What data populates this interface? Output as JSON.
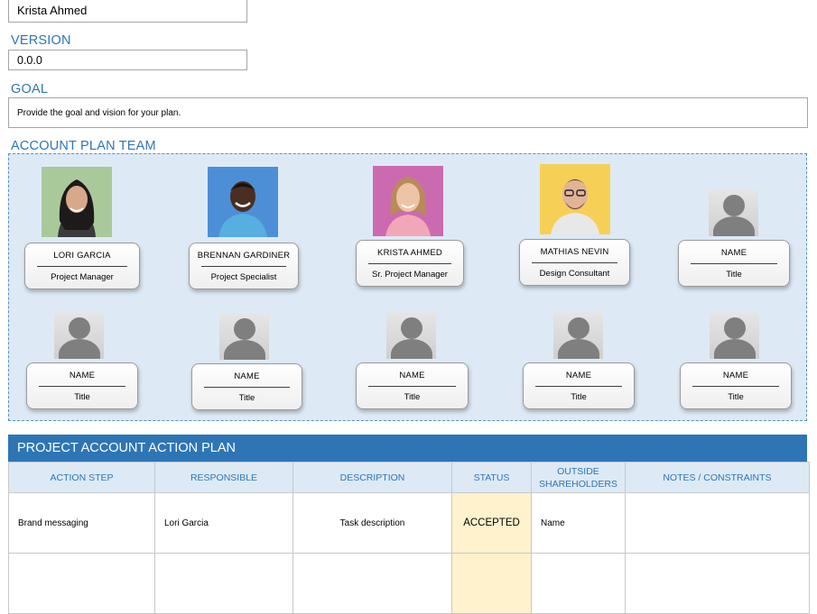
{
  "owner": {
    "value": "Krista Ahmed"
  },
  "version": {
    "label": "VERSION",
    "value": "0.0.0"
  },
  "goal": {
    "label": "GOAL",
    "value": "Provide the goal and vision for your plan."
  },
  "team": {
    "label": "ACCOUNT PLAN TEAM",
    "members": [
      {
        "name": "LORI GARCIA",
        "title": "Project Manager"
      },
      {
        "name": "BRENNAN GARDINER",
        "title": "Project Specialist"
      },
      {
        "name": "KRISTA AHMED",
        "title": "Sr. Project Manager"
      },
      {
        "name": "MATHIAS NEVIN",
        "title": "Design Consultant"
      },
      {
        "name": "NAME",
        "title": "Title"
      },
      {
        "name": "NAME",
        "title": "Title"
      },
      {
        "name": "NAME",
        "title": "Title"
      },
      {
        "name": "NAME",
        "title": "Title"
      },
      {
        "name": "NAME",
        "title": "Title"
      },
      {
        "name": "NAME",
        "title": "Title"
      }
    ]
  },
  "action_plan": {
    "title": "PROJECT ACCOUNT ACTION PLAN",
    "columns": [
      "ACTION STEP",
      "RESPONSIBLE",
      "DESCRIPTION",
      "STATUS",
      "OUTSIDE SHAREHOLDERS",
      "NOTES / CONSTRAINTS"
    ],
    "rows": [
      {
        "step": "Brand messaging",
        "responsible": "Lori Garcia",
        "description": "Task description",
        "status": "ACCEPTED",
        "shareholders": "Name",
        "notes": ""
      }
    ]
  }
}
